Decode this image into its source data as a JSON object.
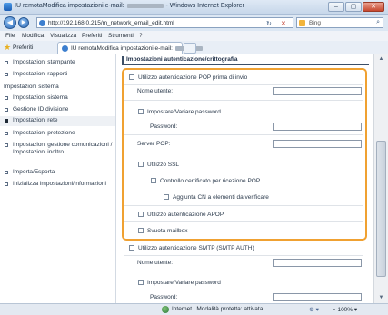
{
  "window": {
    "title_prefix": "IU remotaModifica impostazioni e-mail:",
    "title_suffix": "- Windows Internet Explorer",
    "minimize": "–",
    "maximize": "▢",
    "close": "✕"
  },
  "address_bar": {
    "back_icon": "back-arrow-icon",
    "forward_icon": "forward-arrow-icon",
    "url": "http://192.168.0.215/m_network_email_edit.html",
    "refresh": "↻",
    "stop": "✕",
    "search_placeholder": "Bing",
    "search_glyph": "⌕"
  },
  "menu": [
    "File",
    "Modifica",
    "Visualizza",
    "Preferiti",
    "Strumenti",
    "?"
  ],
  "favorites": {
    "label": "Preferiti",
    "tab_title": "IU remotaModifica impostazioni e-mail:"
  },
  "sidebar": {
    "items_top": [
      {
        "label": "Impostazioni stampante"
      },
      {
        "label": "Impostazioni rapporti"
      }
    ],
    "group_head": "Impostazioni sistema",
    "items": [
      {
        "label": "Impostazioni sistema",
        "selected": false
      },
      {
        "label": "Gestione ID divisione",
        "selected": false
      },
      {
        "label": "Impostazioni rete",
        "selected": true
      },
      {
        "label": "Impostazioni protezione",
        "selected": false
      },
      {
        "label": "Impostazioni gestione comunicazioni / Impostazioni inoltro",
        "selected": false
      },
      {
        "label": "Importa/Esporta",
        "selected": false
      },
      {
        "label": "Inizializza impostazioni/informazioni",
        "selected": false
      }
    ]
  },
  "main": {
    "section_title": "Impostazioni autenticazione/crittografia",
    "pop": {
      "use_pop": "Utilizzo autenticazione POP prima di invio",
      "user_name": "Nome utente:",
      "set_password": "Impostare/Variare password",
      "password": "Password:",
      "server": "Server POP:",
      "use_ssl": "Utilizzo SSL",
      "verify_cert": "Controllo certificato per ricezione POP",
      "add_cn": "Aggiunta CN a elementi da verificare",
      "use_apop": "Utilizzo autenticazione APOP",
      "clear_mailbox": "Svuota mailbox"
    },
    "smtp": {
      "use_smtp": "Utilizzo autenticazione SMTP (SMTP AUTH)",
      "user_name": "Nome utente:",
      "set_password": "Impostare/Variare password",
      "password": "Password:"
    }
  },
  "status": {
    "text": "Internet | Modalità protetta: attivata",
    "security": "⚙ ▾",
    "zoom": "100%"
  },
  "colors": {
    "highlight_border": "#f0a131",
    "titlebar": "#c7d7ea"
  }
}
